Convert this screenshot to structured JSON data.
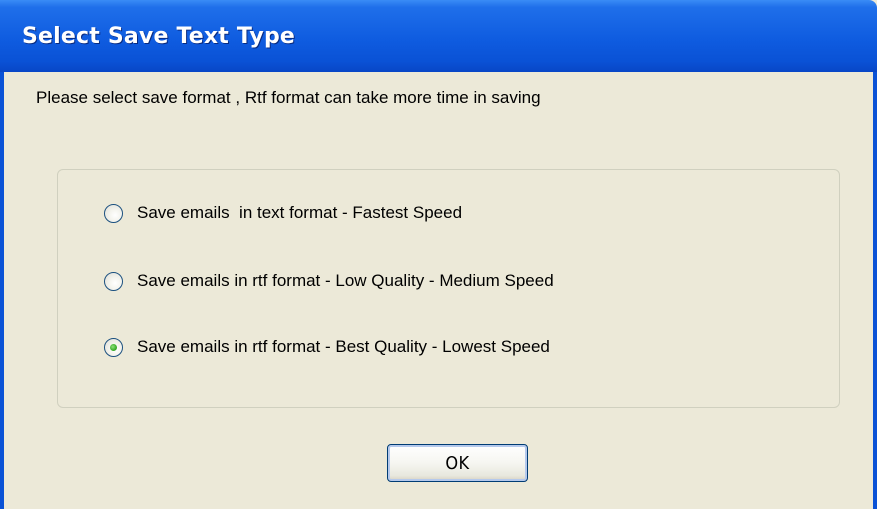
{
  "dialog": {
    "title": "Select Save Text Type",
    "message": "Please select save format , Rtf format can take more time in saving"
  },
  "options": [
    {
      "label": "Save emails  in text format - Fastest Speed",
      "checked": false
    },
    {
      "label": "Save emails in rtf format - Low Quality - Medium Speed",
      "checked": false
    },
    {
      "label": "Save emails in rtf format - Best Quality - Lowest Speed",
      "checked": true
    }
  ],
  "buttons": {
    "ok_label": "OK"
  }
}
